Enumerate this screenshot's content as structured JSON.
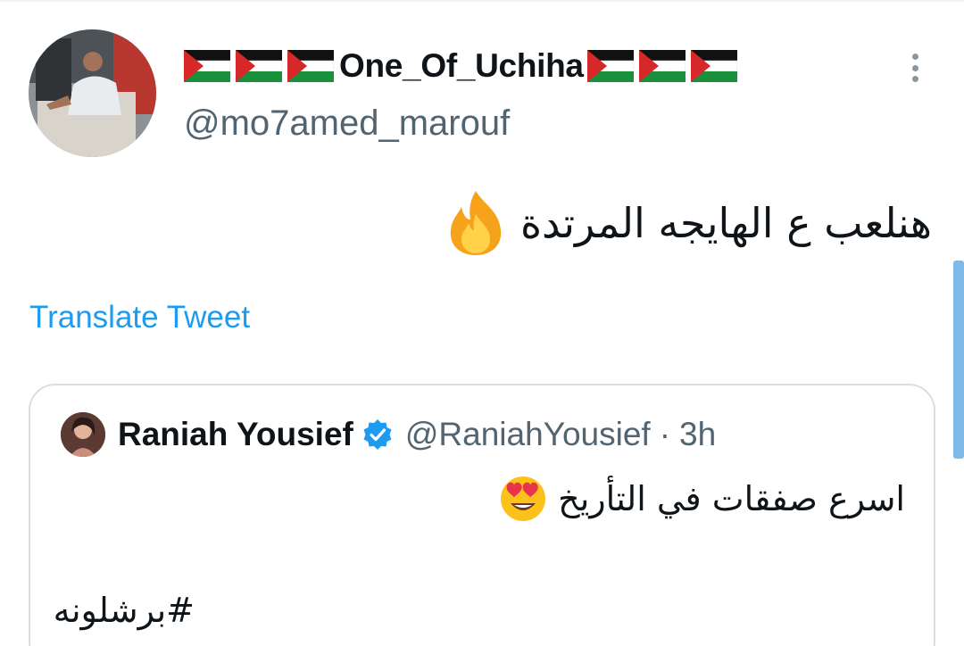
{
  "tweet": {
    "display_name": "One_Of_Uchiha",
    "flags_before_count": 3,
    "flags_after_count": 3,
    "handle": "@mo7amed_marouf",
    "text": "هنلعب ع الهايجه المرتدة",
    "emoji": "fire",
    "translate_label": "Translate Tweet",
    "more_icon": "more-vertical-icon"
  },
  "quoted_tweet": {
    "name": "Raniah Yousief",
    "verified": true,
    "handle": "@RaniahYousief",
    "separator": "·",
    "time": "3h",
    "text": "اسرع صفقات في التأريخ",
    "emoji": "heart-eyes",
    "hashtag": "#برشلونه"
  },
  "colors": {
    "link_blue": "#1d9bf0",
    "secondary_text": "#536471",
    "border": "#d7dfe3",
    "verified_blue": "#1d9bf0"
  }
}
